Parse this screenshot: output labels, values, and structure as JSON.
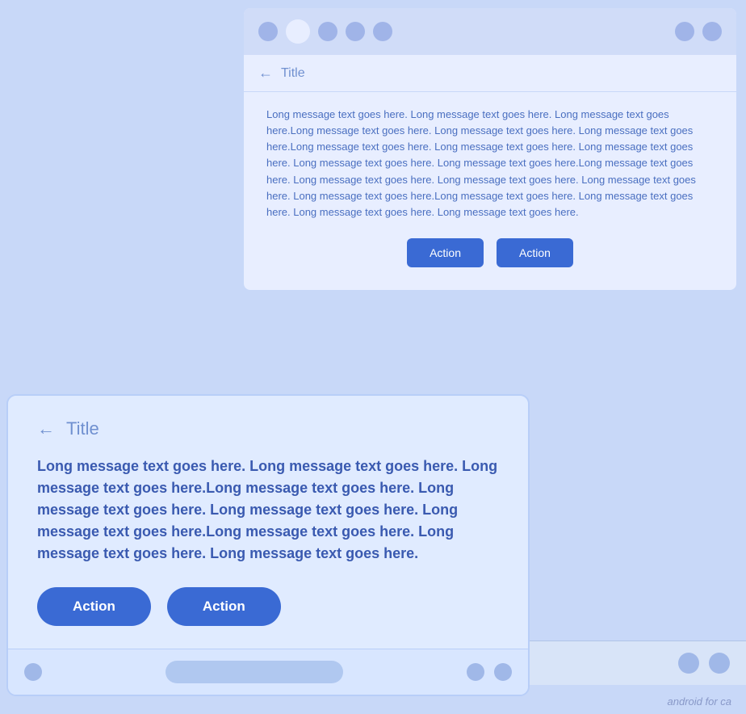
{
  "top_card": {
    "title": "Title",
    "message": "Long message text goes here. Long message text goes here. Long message text goes here.Long message text goes here. Long message text goes here. Long message text goes here.Long message text goes here. Long message text goes here. Long message text goes here. Long message text goes here. Long message text goes here.Long message text goes here. Long message text goes here. Long message text goes here. Long message text goes here. Long message text goes here.Long message text goes here. Long message text goes here. Long message text goes here. Long message text goes here.",
    "button1_label": "Action",
    "button2_label": "Action"
  },
  "bottom_card": {
    "title": "Title",
    "message": "Long message text goes here. Long message text goes here. Long message text goes here.Long message text goes here. Long message text goes here. Long message text goes here. Long message text goes here.Long message text goes here. Long message text goes here. Long message text goes here.",
    "button1_label": "Action",
    "button2_label": "Action"
  },
  "watermark": "android for ca"
}
